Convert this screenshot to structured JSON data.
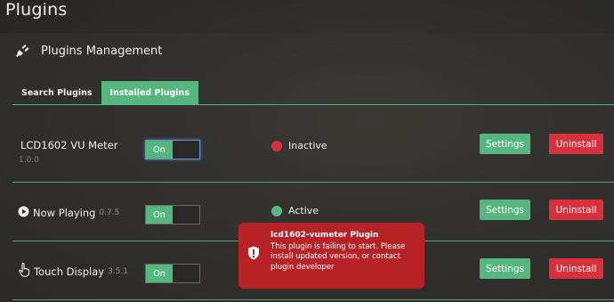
{
  "page": {
    "title": "Plugins"
  },
  "section": {
    "title": "Plugins Management",
    "icon": "plug-icon"
  },
  "tabs": [
    {
      "label": "Search Plugins",
      "active": false
    },
    {
      "label": "Installed Plugins",
      "active": true
    }
  ],
  "plugins": [
    {
      "name": "LCD1602 VU Meter",
      "version": "1.0.0",
      "icon": "",
      "toggle_label": "On",
      "status": "Inactive",
      "status_color": "#d9303d",
      "settings_label": "Settings",
      "uninstall_label": "Uninstall"
    },
    {
      "name": "Now Playing",
      "version": "0.7.5",
      "icon": "play-circle-icon",
      "toggle_label": "On",
      "status": "Active",
      "status_color": "#55b67e",
      "settings_label": "Settings",
      "uninstall_label": "Uninstall"
    },
    {
      "name": "Touch Display",
      "version": "3.5.1",
      "icon": "touch-hand-icon",
      "toggle_label": "On",
      "status": "",
      "status_color": "",
      "settings_label": "Settings",
      "uninstall_label": "Uninstall"
    }
  ],
  "toast": {
    "title": "lcd1602-vumeter Plugin",
    "message": "This plugin is failing to start. Please install updated version, or contact plugin developer",
    "icon": "error-shield-icon",
    "color": "#b72226"
  },
  "colors": {
    "accent": "#55b67e",
    "danger": "#d9303d"
  }
}
